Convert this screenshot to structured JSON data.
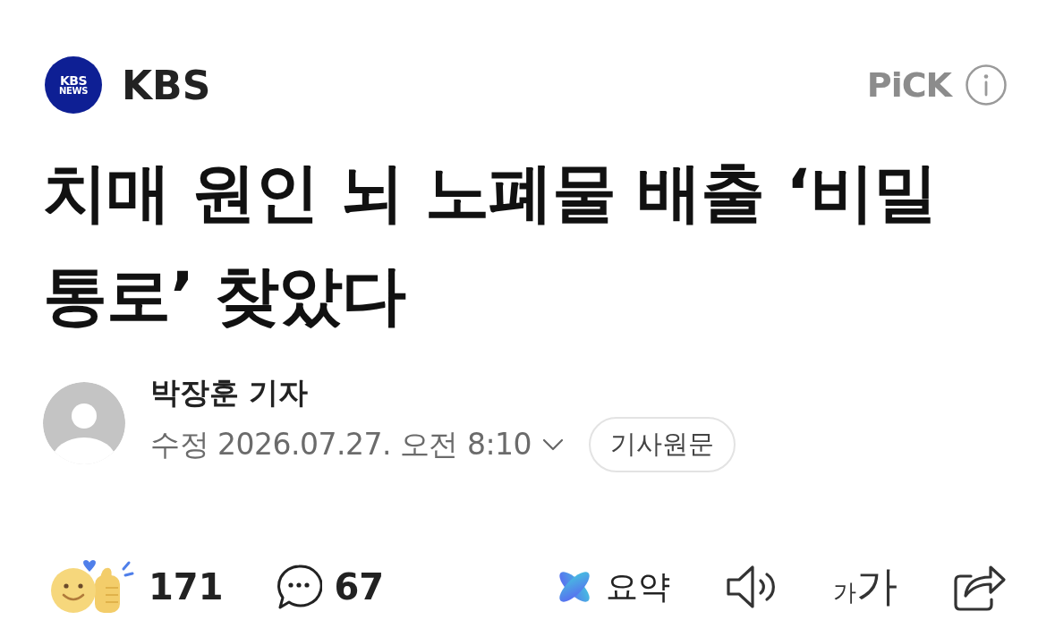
{
  "header": {
    "logo_text": [
      "KBS",
      "NEWS"
    ],
    "source": "KBS",
    "badge": "PiCK"
  },
  "headline": "치매 원인 뇌 노폐물 배출 ‘비밀 통로’ 찾았다",
  "byline": {
    "author": "박장훈 기자",
    "timestamp": "수정 2026.07.27. 오전 8:10",
    "original_article_button": "기사원문"
  },
  "toolbar": {
    "reactions": "171",
    "comments": "67",
    "summary": "요약",
    "font_size": {
      "small": "가",
      "large": "가"
    }
  }
}
